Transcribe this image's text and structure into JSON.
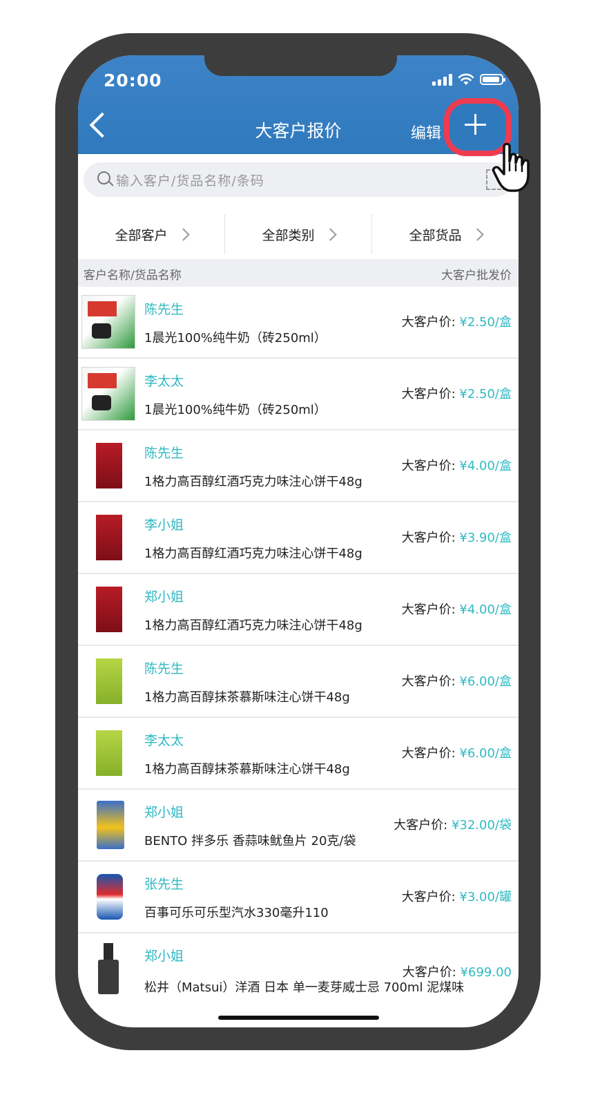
{
  "status": {
    "time": "20:00"
  },
  "nav": {
    "title": "大客户报价",
    "edit_label": "编辑"
  },
  "search": {
    "placeholder": "输入客户/货品名称/条码"
  },
  "filters": [
    {
      "label": "全部客户"
    },
    {
      "label": "全部类别"
    },
    {
      "label": "全部货品"
    }
  ],
  "list_header": {
    "left": "客户名称/货品名称",
    "right": "大客户批发价"
  },
  "price_prefix": "大客户价: ",
  "items": [
    {
      "customer": "陈先生",
      "product": "1晨光100%纯牛奶（砖250ml）",
      "price": "¥2.50/盒",
      "thumb_icon": "milk-carton"
    },
    {
      "customer": "李太太",
      "product": "1晨光100%纯牛奶（砖250ml）",
      "price": "¥2.50/盒",
      "thumb_icon": "milk-carton"
    },
    {
      "customer": "陈先生",
      "product": "1格力高百醇红酒巧克力味注心饼干48g",
      "price": "¥4.00/盒",
      "thumb_icon": "biscuit-box-red"
    },
    {
      "customer": "李小姐",
      "product": "1格力高百醇红酒巧克力味注心饼干48g",
      "price": "¥3.90/盒",
      "thumb_icon": "biscuit-box-red"
    },
    {
      "customer": "郑小姐",
      "product": "1格力高百醇红酒巧克力味注心饼干48g",
      "price": "¥4.00/盒",
      "thumb_icon": "biscuit-box-red"
    },
    {
      "customer": "陈先生",
      "product": "1格力高百醇抹茶慕斯味注心饼干48g",
      "price": "¥6.00/盒",
      "thumb_icon": "biscuit-box-green"
    },
    {
      "customer": "李太太",
      "product": "1格力高百醇抹茶慕斯味注心饼干48g",
      "price": "¥6.00/盒",
      "thumb_icon": "biscuit-box-green"
    },
    {
      "customer": "郑小姐",
      "product": "BENTO 拌多乐 香蒜味鱿鱼片 20克/袋",
      "price": "¥32.00/袋",
      "thumb_icon": "snack-bag"
    },
    {
      "customer": "张先生",
      "product": "百事可乐可乐型汽水330毫升110",
      "price": "¥3.00/罐",
      "thumb_icon": "soda-can"
    },
    {
      "customer": "郑小姐",
      "product": "松井（Matsui）洋酒 日本 单一麦芽威士忌 700ml 泥煤味",
      "price": "¥699.00",
      "thumb_icon": "whisky-bottle"
    }
  ]
}
